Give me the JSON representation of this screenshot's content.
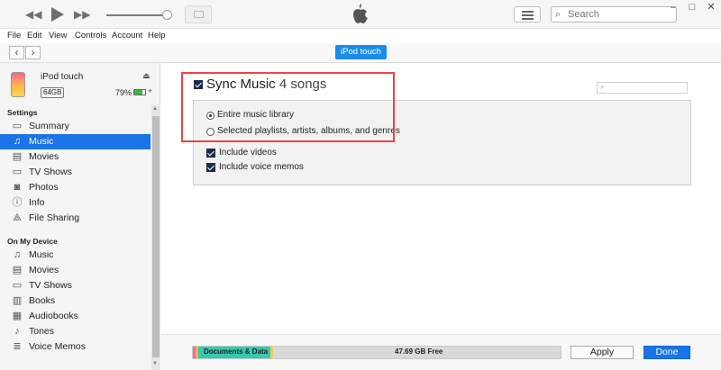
{
  "window": {
    "search_placeholder": "Search",
    "controls": {
      "minimize": "–",
      "maximize": "□",
      "close": "✕"
    }
  },
  "menu": [
    "File",
    "Edit",
    "View",
    "Controls",
    "Account",
    "Help"
  ],
  "nav": {
    "back": "‹",
    "forward": "›",
    "device_button": "iPod touch"
  },
  "device": {
    "name": "iPod touch",
    "capacity": "64GB",
    "battery": "79%",
    "battery_level": 0.79
  },
  "sidebar": {
    "settings_heading": "Settings",
    "settings": [
      {
        "label": "Summary",
        "icon": "summary-icon",
        "glyph": "▭"
      },
      {
        "label": "Music",
        "icon": "music-note-icon",
        "glyph": "♫",
        "selected": true
      },
      {
        "label": "Movies",
        "icon": "film-icon",
        "glyph": "▤"
      },
      {
        "label": "TV Shows",
        "icon": "tv-icon",
        "glyph": "▭"
      },
      {
        "label": "Photos",
        "icon": "camera-icon",
        "glyph": "◙"
      },
      {
        "label": "Info",
        "icon": "info-icon",
        "glyph": "ⓘ"
      },
      {
        "label": "File Sharing",
        "icon": "apps-icon",
        "glyph": "⟁"
      }
    ],
    "device_heading": "On My Device",
    "device_items": [
      {
        "label": "Music",
        "icon": "music-note-icon",
        "glyph": "♫"
      },
      {
        "label": "Movies",
        "icon": "film-icon",
        "glyph": "▤"
      },
      {
        "label": "TV Shows",
        "icon": "tv-icon",
        "glyph": "▭"
      },
      {
        "label": "Books",
        "icon": "book-icon",
        "glyph": "▥"
      },
      {
        "label": "Audiobooks",
        "icon": "audiobook-icon",
        "glyph": "▦"
      },
      {
        "label": "Tones",
        "icon": "bell-icon",
        "glyph": "♪"
      },
      {
        "label": "Voice Memos",
        "icon": "voice-memo-icon",
        "glyph": "≣"
      }
    ]
  },
  "main": {
    "sync_title": "Sync Music",
    "sync_count": "4 songs",
    "options": {
      "entire_library": "Entire music library",
      "selected": "Selected playlists, artists, albums, and genres",
      "include_videos": "Include videos",
      "include_voice_memos": "Include voice memos"
    }
  },
  "storage": {
    "documents_label": "Documents & Data",
    "free_label": "47.69 GB Free"
  },
  "buttons": {
    "apply": "Apply",
    "done": "Done"
  },
  "colors": {
    "accent": "#1a73e8",
    "highlight": "#e84545"
  }
}
